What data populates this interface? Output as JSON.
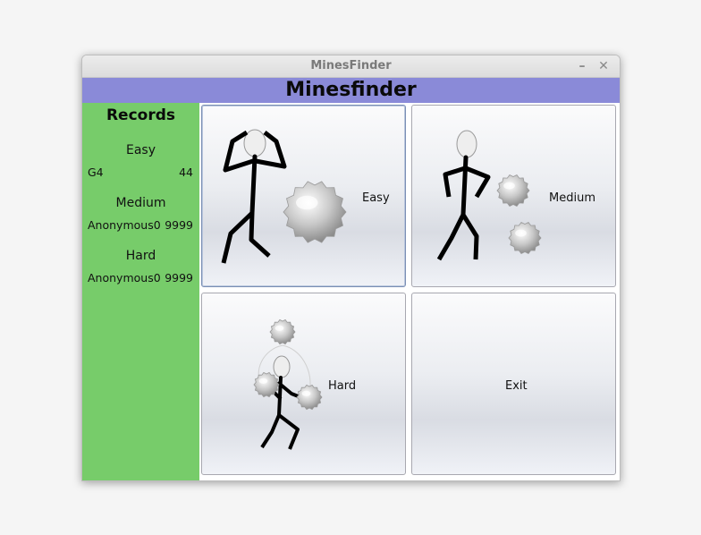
{
  "window": {
    "title": "MinesFinder",
    "minimize_icon": "minimize-icon",
    "close_icon": "close-icon"
  },
  "app": {
    "title": "Minesfinder"
  },
  "records": {
    "title": "Records",
    "levels": [
      {
        "level": "Easy",
        "name": "G4",
        "score": "44"
      },
      {
        "level": "Medium",
        "name": "Anonymous0",
        "score": "9999"
      },
      {
        "level": "Hard",
        "name": "Anonymous0",
        "score": "9999"
      }
    ]
  },
  "buttons": {
    "easy": "Easy",
    "medium": "Medium",
    "hard": "Hard",
    "exit": "Exit"
  },
  "colors": {
    "header": "#8a8ad8",
    "records_panel": "#77cc6a"
  }
}
